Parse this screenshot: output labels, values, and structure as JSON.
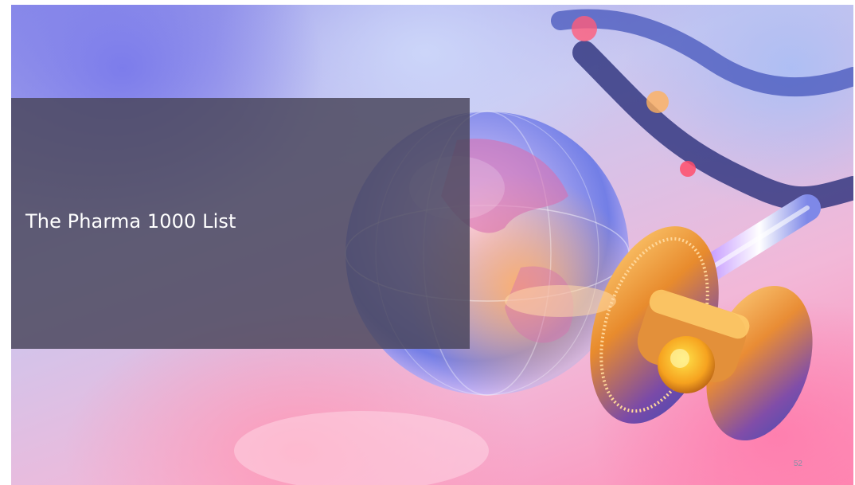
{
  "slide": {
    "title": "The Pharma 1000 List",
    "slide_number": "52"
  },
  "image": {
    "subject": "glass globe and stethoscope",
    "icons": [
      "globe-icon",
      "stethoscope-icon"
    ]
  },
  "colors": {
    "panel": "#4a465c",
    "title_text": "#ffffff",
    "slide_number": "#8a8fa6",
    "accent_blue": "#7b86ea",
    "accent_pink": "#ff8cb4",
    "accent_gold": "#f5a623"
  }
}
